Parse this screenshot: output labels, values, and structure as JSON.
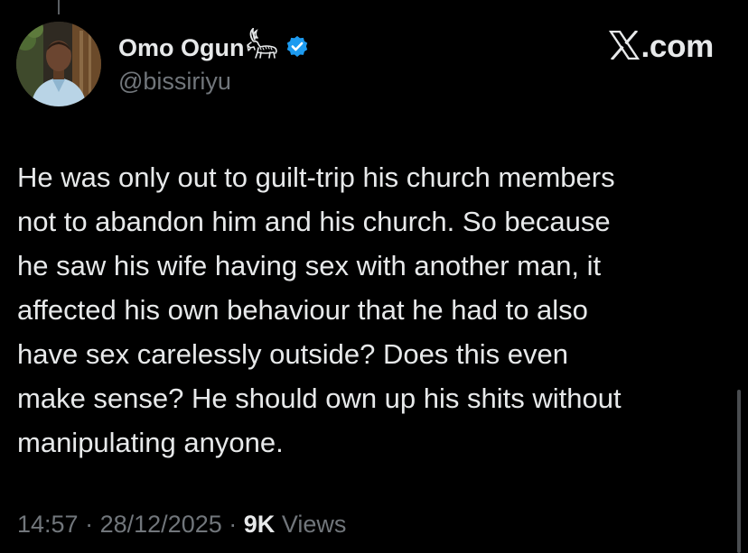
{
  "author": {
    "display_name": "Omo Ogun",
    "handle": "@bissiriyu",
    "verified": true,
    "name_emoji": "goat-icon"
  },
  "brand": {
    "text": ".com",
    "logo": "x-logo-icon"
  },
  "tweet": {
    "text": "He was only out to guilt-trip his church members\nnot to abandon him and his church. So because\nhe saw his wife having sex with another man, it\naffected his own behaviour that he had to also\nhave sex carelessly outside? Does this even\nmake sense? He should own up his shits without\nmanipulating anyone."
  },
  "meta": {
    "time": "14:57",
    "date": "28/12/2025",
    "separator": "·",
    "views_count": "9K",
    "views_label": "Views"
  },
  "colors": {
    "background": "#000000",
    "text_primary": "#e7e9ea",
    "text_secondary": "#71767b",
    "verified_badge": "#1d9bf0"
  }
}
